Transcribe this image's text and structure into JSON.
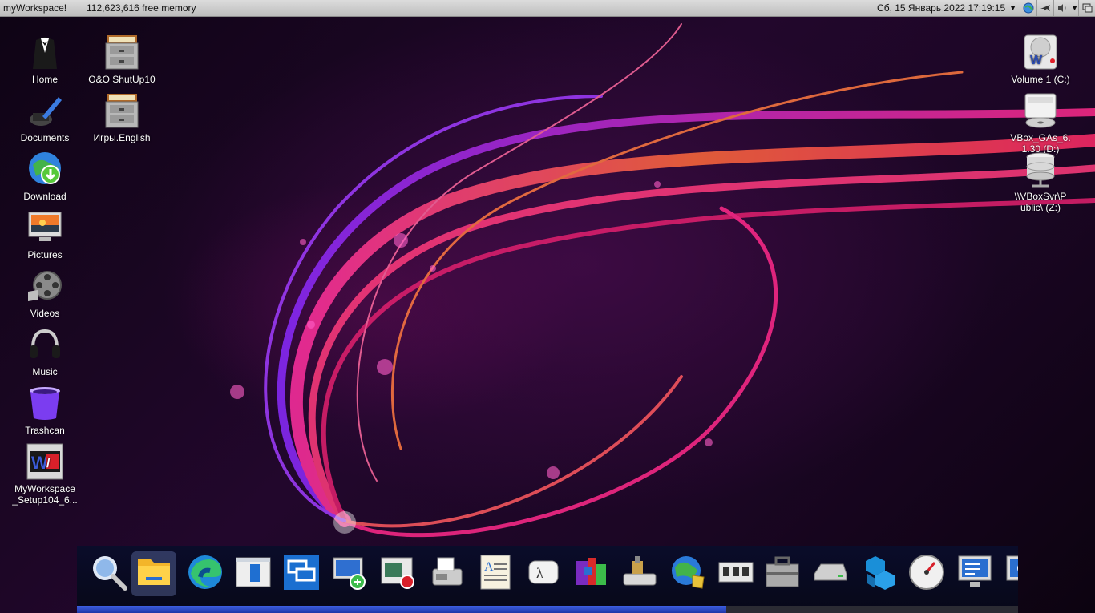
{
  "menubar": {
    "app_name": "myWorkspace!",
    "memory": "112,623,616 free memory",
    "clock": "Сб, 15 Январь 2022 17:19:15"
  },
  "desktop_left": [
    {
      "label": "Home",
      "icon": "tuxedo-icon"
    },
    {
      "label": "Documents",
      "icon": "pen-ink-icon"
    },
    {
      "label": "Download",
      "icon": "globe-download-icon"
    },
    {
      "label": "Pictures",
      "icon": "monitor-picture-icon"
    },
    {
      "label": "Videos",
      "icon": "film-reel-icon"
    },
    {
      "label": "Music",
      "icon": "headphones-icon"
    },
    {
      "label": "Trashcan",
      "icon": "trash-icon"
    },
    {
      "label": "MyWorkspace\n_Setup104_6...",
      "icon": "myworkspace-logo-icon"
    }
  ],
  "desktop_second_col": [
    {
      "label": "O&O ShutUp10",
      "icon": "file-cabinet-icon"
    },
    {
      "label": "Игры.English",
      "icon": "file-cabinet-icon"
    }
  ],
  "desktop_right": [
    {
      "label": "Volume 1 (C:)",
      "icon": "hard-drive-icon"
    },
    {
      "label": "VBox_GAs_6.\n1.30 (D:)",
      "icon": "cd-drive-icon"
    },
    {
      "label": "\\\\VBoxSvr\\P\nublic\\ (Z:)",
      "icon": "network-drive-icon"
    }
  ],
  "dock": [
    "magnifier-icon",
    "file-explorer-icon",
    "edge-browser-icon",
    "window-app-icon",
    "remote-desktop-icon",
    "monitor-connect-icon",
    "screen-recorder-icon",
    "fax-printer-icon",
    "text-document-icon",
    "lambda-calculator-icon",
    "control-panel-icon",
    "usb-drive-icon",
    "network-globe-icon",
    "memory-chip-icon",
    "toolbox-icon",
    "disk-drive-icon",
    "cubes-icon",
    "gauge-icon",
    "task-monitor-icon",
    "screen-partial-icon"
  ]
}
